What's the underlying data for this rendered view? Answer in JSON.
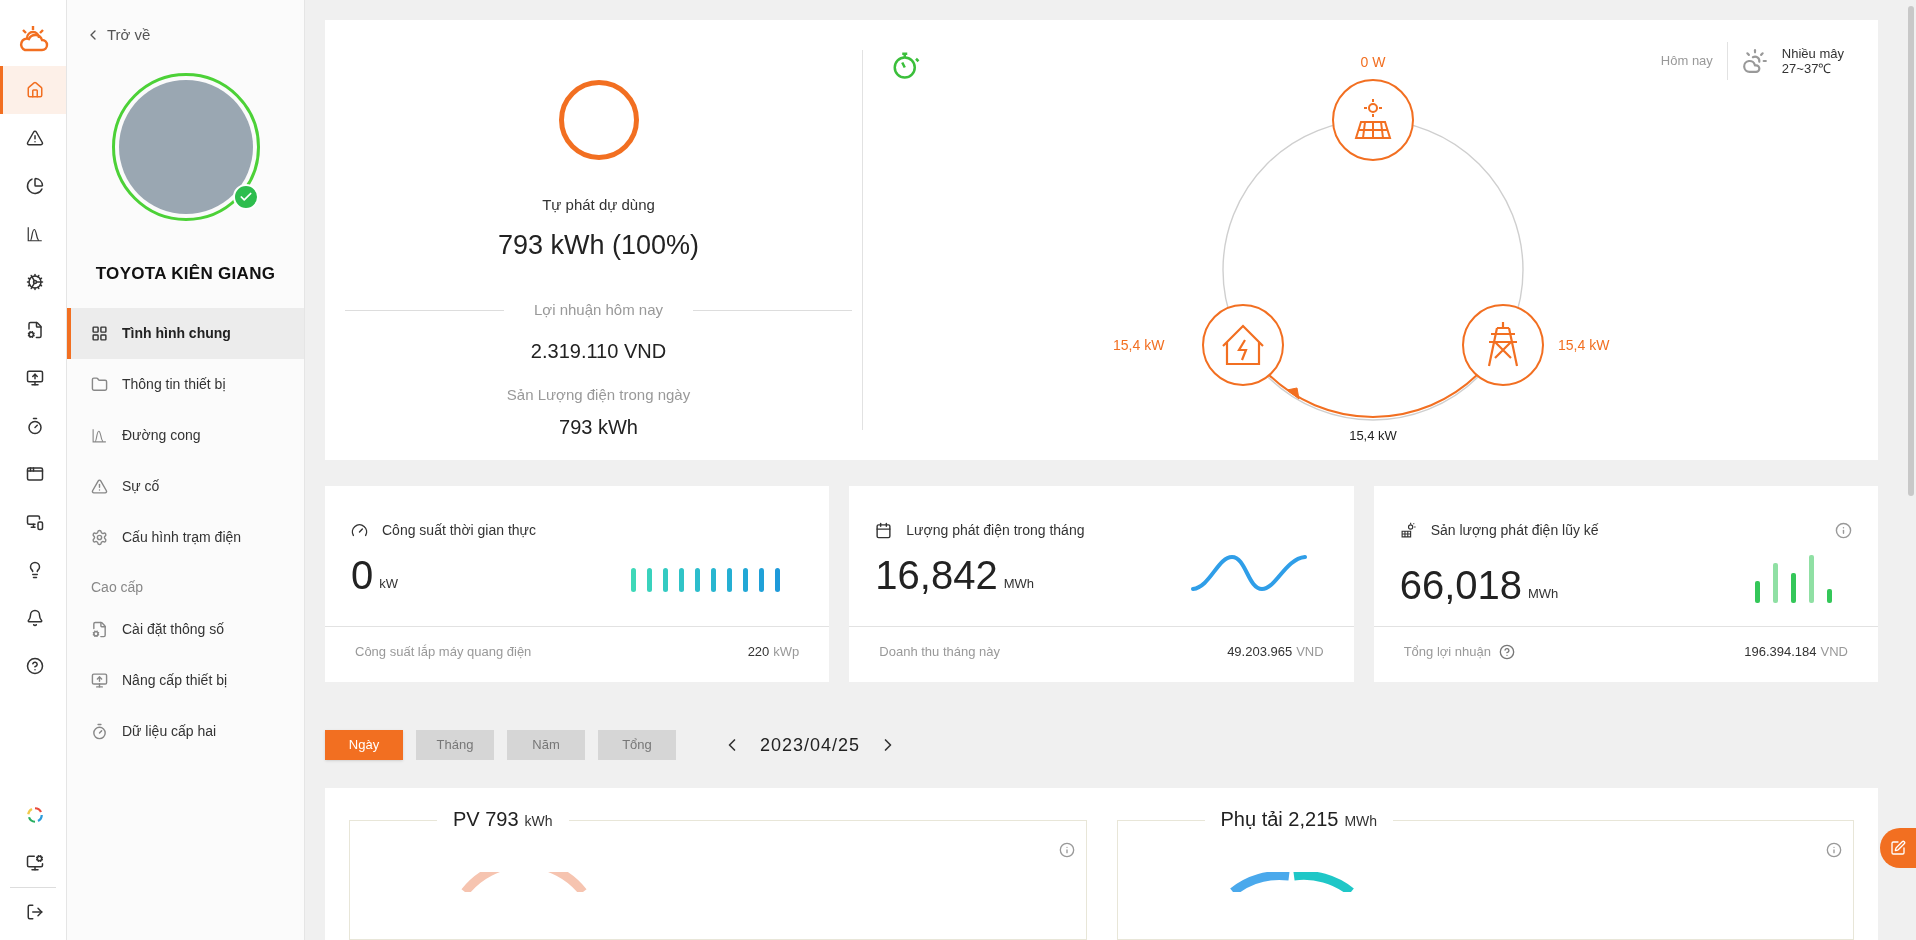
{
  "rail": {
    "top": [
      {
        "kind": "home",
        "selected": true
      },
      {
        "kind": "alert",
        "selected": false
      },
      {
        "kind": "pie",
        "selected": false
      },
      {
        "kind": "curve",
        "selected": false
      },
      {
        "kind": "gears",
        "selected": false
      },
      {
        "kind": "file-gear",
        "selected": false
      },
      {
        "kind": "monitor-up",
        "selected": false
      },
      {
        "kind": "timer",
        "selected": false
      },
      {
        "kind": "window",
        "selected": false
      },
      {
        "kind": "devices",
        "selected": false
      },
      {
        "kind": "bulb",
        "selected": false
      },
      {
        "kind": "bell",
        "selected": false
      },
      {
        "kind": "help",
        "selected": false
      }
    ],
    "bottom": [
      {
        "kind": "swirl",
        "selected": false
      },
      {
        "kind": "monitor-gear",
        "selected": false
      },
      {
        "kind": "logout",
        "selected": false
      }
    ]
  },
  "panel": {
    "back": "Trở về",
    "station": {
      "name": "TOYOTA KIÊN GIANG",
      "online": true
    },
    "menu": [
      {
        "kind": "grid",
        "label": "Tình hình chung",
        "selected": true
      },
      {
        "kind": "folder",
        "label": "Thông tin thiết bị",
        "selected": false
      },
      {
        "kind": "curve",
        "label": "Đường cong",
        "selected": false
      },
      {
        "kind": "alert",
        "label": "Sự cố",
        "selected": false
      },
      {
        "kind": "gear",
        "label": "Cấu hình trạm điện",
        "selected": false
      }
    ],
    "advanced": {
      "heading": "Cao cấp",
      "items": [
        {
          "kind": "file-gear",
          "label": "Cài đặt thông số",
          "selected": false
        },
        {
          "kind": "monitor-up",
          "label": "Nâng cấp thiết bị",
          "selected": false
        },
        {
          "kind": "timer",
          "label": "Dữ liệu cấp hai",
          "selected": false
        }
      ]
    }
  },
  "overview": {
    "self_use": {
      "label": "Tự phát dự dùng",
      "value": "793 kWh (100%)"
    },
    "profit": {
      "label": "Lợi nhuận hôm nay",
      "value": "2.319.110 VND"
    },
    "output": {
      "label": "Sản Lượng điện trong ngày",
      "value": "793 kWh"
    }
  },
  "flow": {
    "weather": {
      "day": "Hôm nay",
      "condition": "Nhiều mây",
      "range": "27~37℃"
    },
    "pv": "0 W",
    "load": "15,4 kW",
    "grid": "15,4 kW",
    "grid_to_load": "15,4 kW"
  },
  "stats": [
    {
      "kind": "bars",
      "title": "Công suất thời gian thực",
      "value": "0",
      "unit": "kW",
      "footer_label": "Công suất lắp máy quang điện",
      "footer_value": "220",
      "footer_unit": "kWp",
      "info": false,
      "help": false
    },
    {
      "kind": "wave",
      "title": "Lượng phát điện trong tháng",
      "value": "16,842",
      "unit": "MWh",
      "footer_label": "Doanh thu tháng này",
      "footer_value": "49.203.965",
      "footer_unit": "VND",
      "info": false,
      "help": false
    },
    {
      "kind": "columns",
      "title": "Sản lượng phát điện lũy kế",
      "value": "66,018",
      "unit": "MWh",
      "footer_label": "Tổng lợi nhuận",
      "footer_value": "196.394.184",
      "footer_unit": "VND",
      "info": true,
      "help": true
    }
  ],
  "periods": [
    {
      "label": "Ngày",
      "selected": true
    },
    {
      "label": "Tháng",
      "selected": false
    },
    {
      "label": "Năm",
      "selected": false
    },
    {
      "label": "Tổng",
      "selected": false
    }
  ],
  "date": "2023/04/25",
  "charts": [
    {
      "kind": "pv",
      "title": "PV 793",
      "unit": "kWh"
    },
    {
      "kind": "load",
      "title": "Phụ tải 2,215",
      "unit": "MWh"
    }
  ]
}
